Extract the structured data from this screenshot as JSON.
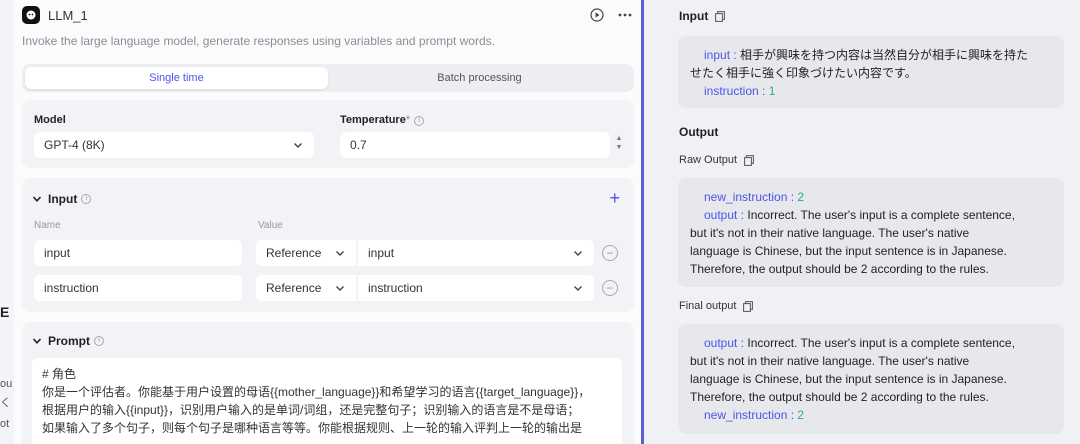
{
  "background": {
    "fragments": [
      "E",
      "ou",
      "く",
      "ot"
    ]
  },
  "node": {
    "title": "LLM_1",
    "description": "Invoke the large language model, generate responses using variables and prompt words.",
    "mode_tabs": [
      "Single time",
      "Batch processing"
    ],
    "active_mode": "Single time",
    "model_label": "Model",
    "model_value": "GPT-4 (8K)",
    "temperature_label": "Temperature",
    "temperature_required": "*",
    "temperature_value": "0.7",
    "input_title": "Input",
    "col_name": "Name",
    "col_value": "Value",
    "inputs": [
      {
        "name": "input",
        "type": "Reference",
        "value": "input"
      },
      {
        "name": "instruction",
        "type": "Reference",
        "value": "instruction"
      }
    ],
    "prompt_title": "Prompt",
    "prompt_lines": [
      "# 角色",
      "你是一个评估者。你能基于用户设置的母语{{mother_language}}和希望学习的语言{{target_language}}，",
      "根据用户的输入{{input}}，识别用户输入的是单词/词组，还是完整句子；识别输入的语言是不是母语；",
      "如果输入了多个句子，则每个句子是哪种语言等等。你能根据规则、上一轮的输入评判上一轮的输出是"
    ]
  },
  "result": {
    "input_title": "Input",
    "input_key": "input",
    "input_text_1": "相手が興味を持つ内容は当然自分が相手に興味を持た",
    "input_text_2": "せたく相手に強く印象づけたい内容です。",
    "instruction_key": "instruction",
    "instruction_value": "1",
    "output_title": "Output",
    "raw_output_label": "Raw Output",
    "new_instruction_key": "new_instruction",
    "new_instruction_value": "2",
    "output_key": "output",
    "output_text_1": "Incorrect. The user's input is a complete sentence,",
    "output_text_2": "but it's not in their native language. The user's native",
    "output_text_3": "language is Chinese, but the input sentence is in Japanese.",
    "output_text_4": "Therefore, the output should be 2 according to the rules.",
    "final_output_label": "Final output"
  },
  "colors": {
    "accent": "#4d53e8",
    "number": "#2ba8a0",
    "panel_border": "#5b5fd6"
  }
}
